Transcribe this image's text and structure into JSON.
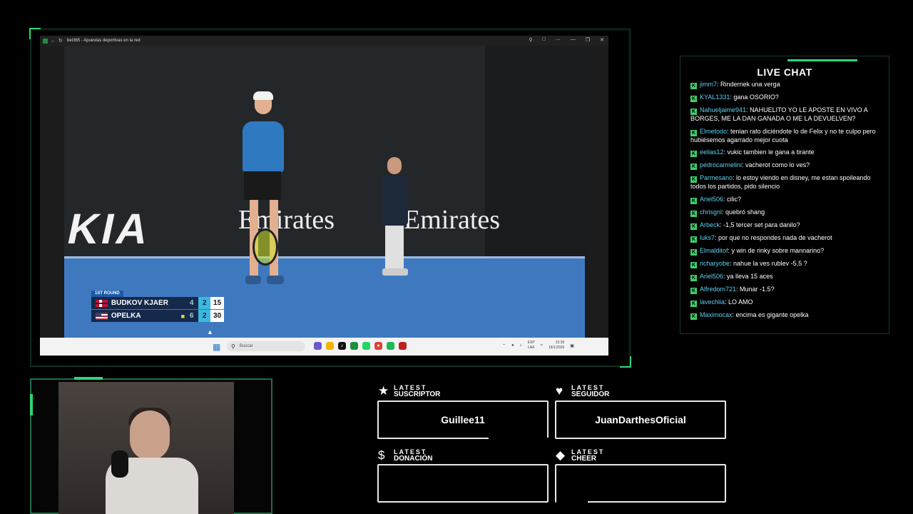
{
  "browser": {
    "tab_title": "bet365 - Apuestas deportivas en la red",
    "controls": [
      "zoom-icon",
      "extensions-icon",
      "share-icon",
      "minimize-icon",
      "maximize-icon",
      "close-icon"
    ]
  },
  "scoreboard": {
    "round": "1ST ROUND",
    "players": [
      {
        "name": "BUDKOV KJAER",
        "flag": "NOR",
        "set1": "4",
        "set2": "2",
        "game": "15",
        "serving": false
      },
      {
        "name": "OPELKA",
        "flag": "USA",
        "set1": "6",
        "set2": "2",
        "game": "30",
        "serving": true
      }
    ]
  },
  "court_ads": {
    "kia": "KIA",
    "emirates_left": "Emirates",
    "emirates_right": "Emirates"
  },
  "taskbar": {
    "search_placeholder": "Buscar",
    "lang_top": "ESP",
    "lang_bottom": "LAA",
    "time": "23:39",
    "date": "18/1/2026"
  },
  "chat": {
    "title": "LIVE CHAT",
    "messages": [
      {
        "user": "jimm7",
        "text": "Rindernek una verga"
      },
      {
        "user": "KYAL1331",
        "text": "gana OSORIO?"
      },
      {
        "user": "Nahueljaime941",
        "text": "NAHUELITO YO LE APOSTE EN VIVO A BORGES, ME LA DAN GANADA O ME LA DEVUELVEN?"
      },
      {
        "user": "Elmetodo",
        "text": "tenian rato diciéndote lo de Felix y no te culpo pero hubiésemos agarrado mejor cuota"
      },
      {
        "user": "eelias12",
        "text": "vukic tambien le gana a tirante"
      },
      {
        "user": "pedrocarmelini",
        "text": "vacherot como lo ves?"
      },
      {
        "user": "Parmesano",
        "text": "lo estoy viendo en disney, me estan spoileando todos los partidos, pido silencio"
      },
      {
        "user": "Ariel506",
        "text": "cilic?"
      },
      {
        "user": "chrisgnl",
        "text": "quebró shang"
      },
      {
        "user": "Arbeck",
        "text": "-1,5 tercer set para danilo?"
      },
      {
        "user": "luks7",
        "text": "por que no respondes nada de vacherot"
      },
      {
        "user": "Elmalditof",
        "text": "y win de rinky sobre mannarino?"
      },
      {
        "user": "richaryobe",
        "text": "nahue la ves rublev -5,5 ?"
      },
      {
        "user": "Ariel506",
        "text": "ya lleva 15 aces"
      },
      {
        "user": "Alfredom721",
        "text": "Munar -1.5?"
      },
      {
        "user": "lavechiia",
        "text": "LO AMO"
      },
      {
        "user": "Maximocax",
        "text": "encima es gigante opelka"
      }
    ]
  },
  "alerts": {
    "suscriptor": {
      "top": "LATEST",
      "bottom": "SUSCRIPTOR",
      "icon": "star-icon",
      "value": "Guillee11"
    },
    "seguidor": {
      "top": "LATEST",
      "bottom": "SEGUIDOR",
      "icon": "heart-icon",
      "value": "JuanDarthesOficial"
    },
    "donacion": {
      "top": "LATEST",
      "bottom": "DONACIÓN",
      "icon": "dollar-icon",
      "value": ""
    },
    "cheer": {
      "top": "LATEST",
      "bottom": "CHEER",
      "icon": "diamond-icon",
      "value": ""
    }
  },
  "colors": {
    "accent": "#2fd47a",
    "chat_username": "#5fd0ef",
    "court": "#3e79c0",
    "scoreboard": "#15294a"
  }
}
